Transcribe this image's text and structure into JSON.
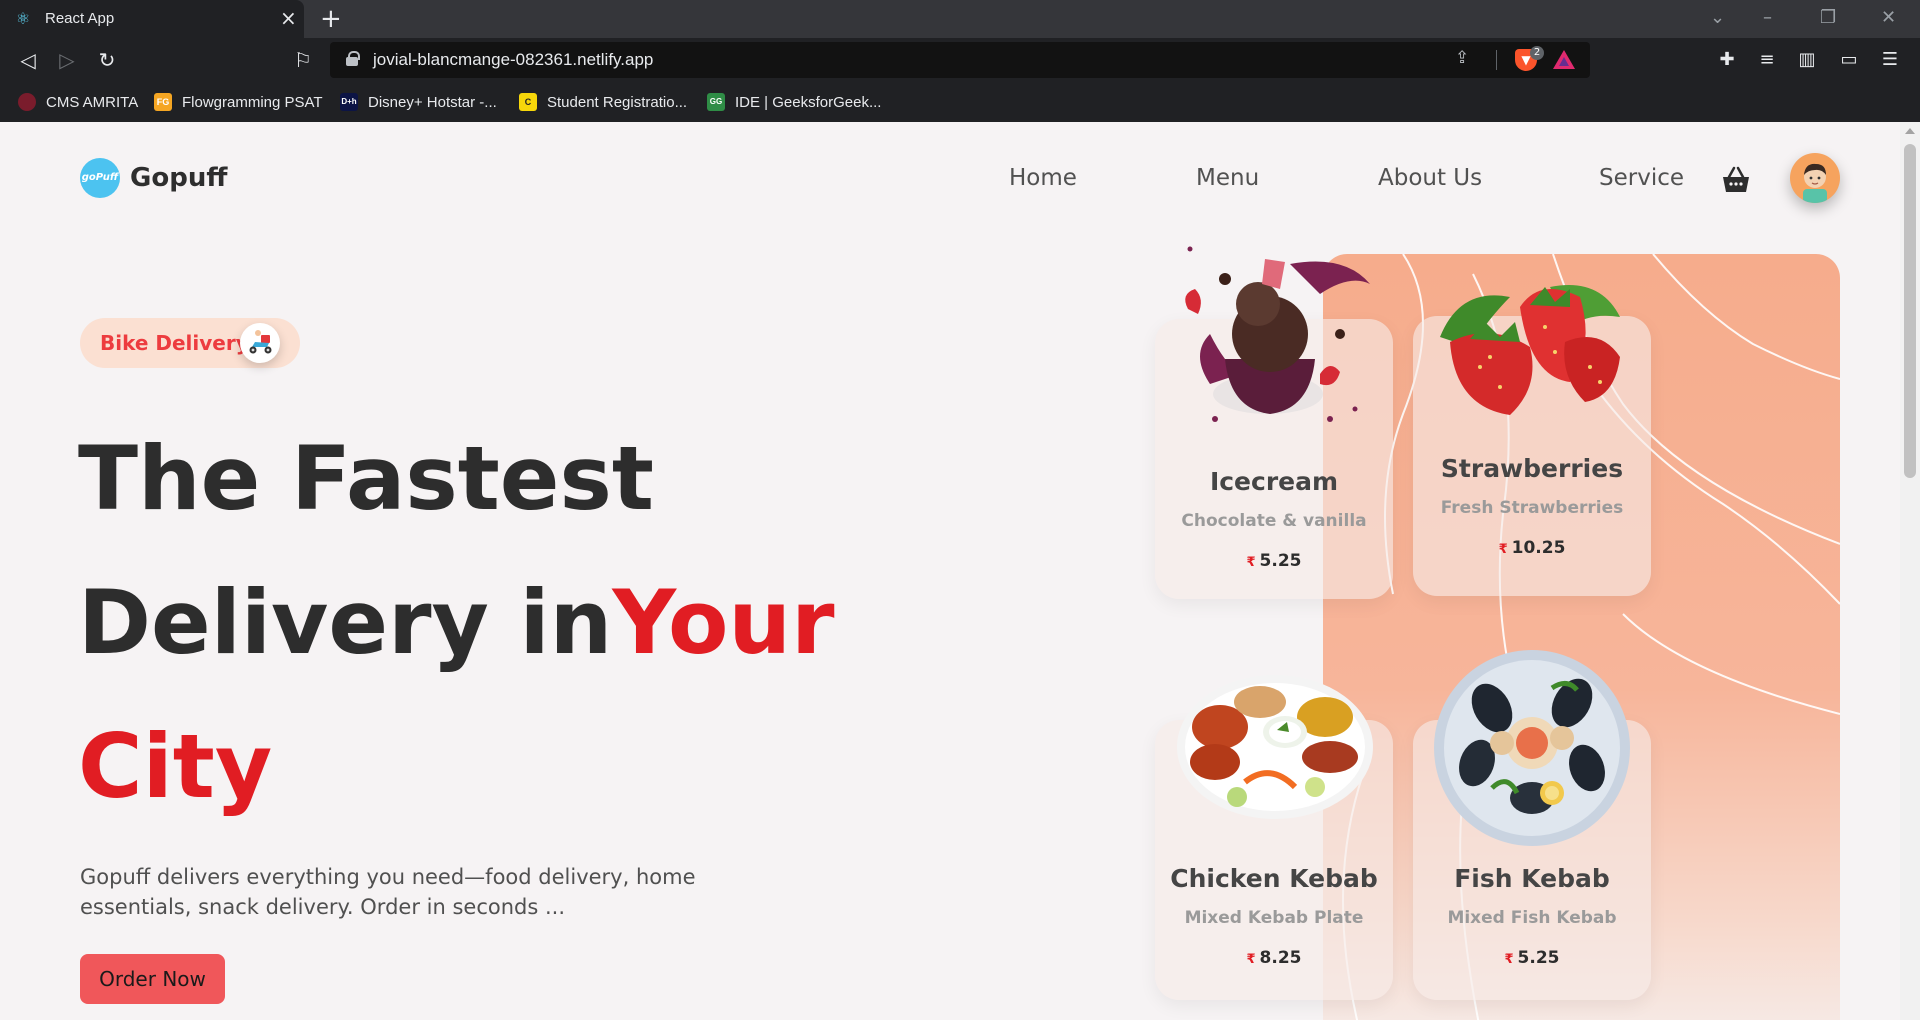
{
  "browser": {
    "tab_title": "React App",
    "new_tab": "+",
    "url": "jovial-blancmange-082361.netlify.app",
    "brave_badge": "2",
    "bookmarks": [
      "CMS AMRITA",
      "Flowgramming PSAT",
      "Disney+ Hotstar -...",
      "Student Registratio...",
      "IDE | GeeksforGeek..."
    ],
    "bookmark_icons": [
      "",
      "FG",
      "D+h",
      "C",
      "GG"
    ]
  },
  "site": {
    "logo_mark": "goPuff",
    "brand": "Gopuff",
    "nav": [
      "Home",
      "Menu",
      "About Us",
      "Service"
    ]
  },
  "hero": {
    "badge": "Bike Delivery",
    "line1": "The Fastest",
    "line2a": "Delivery in",
    "line2b": "Your",
    "line3": "City",
    "description": "Gopuff delivers everything you need—food delivery, home essentials, snack delivery. Order in seconds ...",
    "cta": "Order Now"
  },
  "cards": [
    {
      "name": "Icecream",
      "sub": "Chocolate & vanilla",
      "currency": "₹",
      "price": "5.25"
    },
    {
      "name": "Strawberries",
      "sub": "Fresh Strawberries",
      "currency": "₹",
      "price": "10.25"
    },
    {
      "name": "Chicken Kebab",
      "sub": "Mixed Kebab Plate",
      "currency": "₹",
      "price": "8.25"
    },
    {
      "name": "Fish Kebab",
      "sub": "Mixed Fish Kebab",
      "currency": "₹",
      "price": "5.25"
    }
  ],
  "colors": {
    "accent": "#e11d23",
    "button": "#f0575a",
    "panel": "#f6ac8c",
    "badge_bg": "#fbe0d2"
  }
}
